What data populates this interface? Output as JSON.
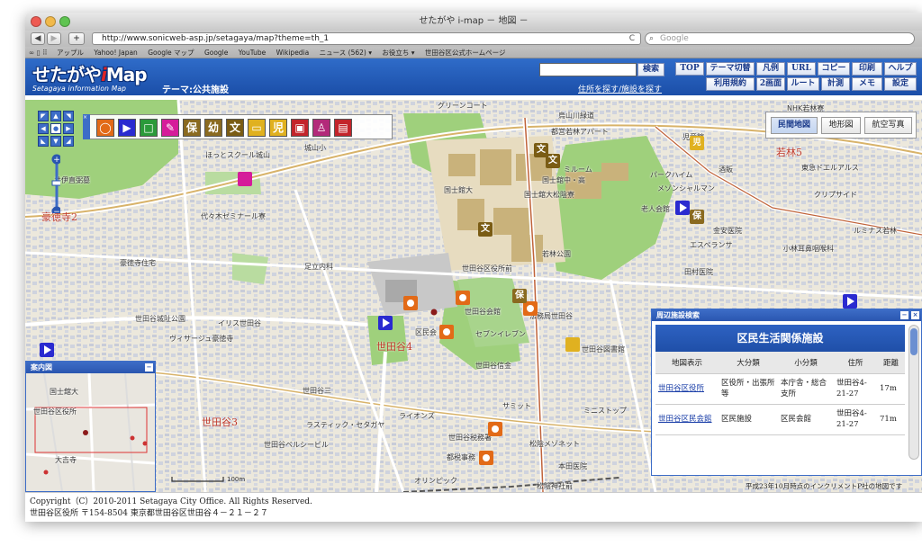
{
  "window": {
    "title": "せたがや i-map － 地図 －"
  },
  "browser": {
    "back": "◀",
    "forward": "▶",
    "new_tab": "+",
    "url": "http://www.sonicweb-asp.jp/setagaya/map?theme=th_1",
    "reload": "C",
    "search_placeholder": "Google",
    "bookmarks": [
      "アップル",
      "Yahoo! Japan",
      "Google マップ",
      "Google",
      "YouTube",
      "Wikipedia",
      "ニュース (562) ▾",
      "お役立ち ▾",
      "世田谷区公式ホームページ"
    ]
  },
  "site": {
    "logo_main_a": "せたがや",
    "logo_main_i": "i",
    "logo_main_b": "Map",
    "logo_sub": "Setagaya information Map",
    "theme": "テーマ:公共施設",
    "search_button": "検索",
    "addr_search": "住所を探す",
    "facility_search": "/施設を探す",
    "nav_row1": [
      "TOP",
      "テーマ切替",
      "凡例",
      "URL",
      "コピー",
      "印刷",
      "ヘルプ"
    ],
    "nav_row2": [
      "利用規約",
      "2画面",
      "ルート",
      "計測",
      "メモ",
      "設定"
    ]
  },
  "map": {
    "types": [
      "民間地図",
      "地形図",
      "航空写真"
    ],
    "categories": [
      "保",
      "幼",
      "文",
      "児"
    ],
    "district_labels": [
      "豪徳寺2",
      "世田谷4",
      "世田谷3",
      "若林5"
    ],
    "labels": [
      "グリーンコート",
      "烏山川緑道",
      "都営若林アパート",
      "NHK若林寮",
      "城山小",
      "ほっとスクール城山",
      "井伊直弼墓",
      "代々木ゼミナール寮",
      "国士館大",
      "国士舘中・高",
      "国士舘大松陰寮",
      "ミルーム",
      "パークハイム",
      "メゾンシャルマン",
      "老人会館",
      "若林公園",
      "豪徳寺住宅",
      "足立内科",
      "世田谷区役所前",
      "世田谷会館",
      "法務局世田谷",
      "世田谷城阯公園",
      "イリス世田谷",
      "区民会",
      "ヴィサージュ豪徳寺",
      "セブンイレブン",
      "世田谷信金",
      "世田谷図書館",
      "世田谷三",
      "ラスティック・セタガヤ",
      "ライオンズ",
      "サミット",
      "世田谷ベルシービル",
      "都税事務",
      "松陰メゾネット",
      "本田医院",
      "オリンピック",
      "松陰神社前",
      "東急ドエルアルス",
      "クリプサイド",
      "田村医院",
      "金安医院",
      "エスペランサ",
      "小林耳鼻咽喉科",
      "ルミナス若林",
      "酒販",
      "児童館",
      "世田谷税務署",
      "ミニストップ"
    ],
    "scale": "100m",
    "credit": "平成23年10月時点のインクリメントP社の地図です"
  },
  "guide": {
    "title": "案内図",
    "labels": [
      "国士舘大",
      "世田谷区役所",
      "大吉寺"
    ]
  },
  "nearby": {
    "panel_title": "周辺施設検索",
    "heading": "区民生活関係施設",
    "columns": [
      "地図表示",
      "大分類",
      "小分類",
      "住所",
      "距離"
    ],
    "rows": [
      {
        "name": "世田谷区役所",
        "major": "区役所・出張所等",
        "minor": "本庁舎・総合支所",
        "address": "世田谷4-21-27",
        "distance": "17m"
      },
      {
        "name": "世田谷区民会館",
        "major": "区民施設",
        "minor": "区民会館",
        "address": "世田谷4-21-27",
        "distance": "71m"
      }
    ]
  },
  "footer": {
    "copyright": "Copyright（C）2010-2011 Setagaya City Office. All Rights Reserved.",
    "address": "世田谷区役所 〒154-8504 東京都世田谷区世田谷４－２１－２７"
  }
}
